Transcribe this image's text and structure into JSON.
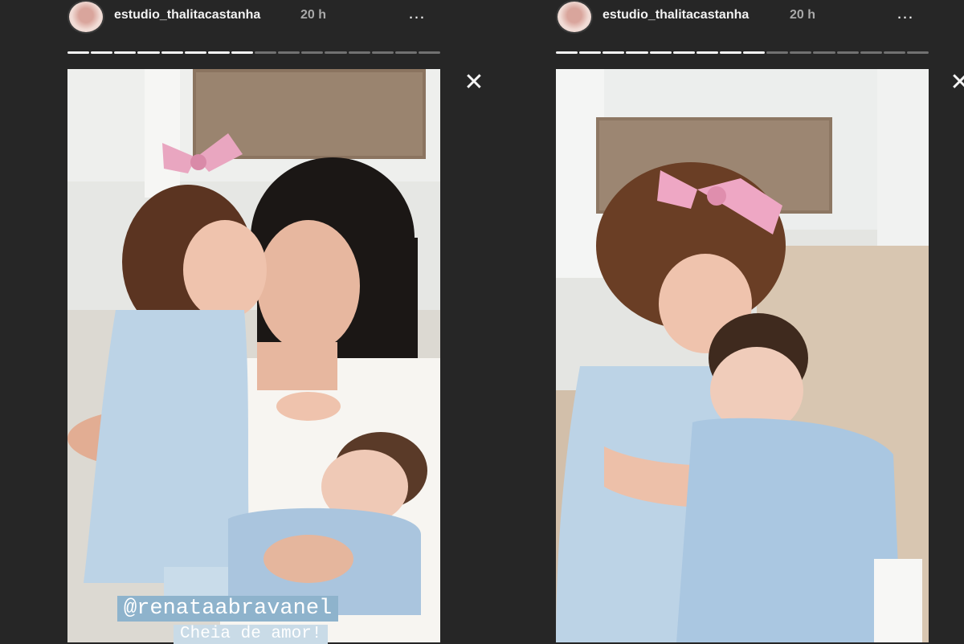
{
  "stories": [
    {
      "username": "estudio_thalitacastanha",
      "time": "20 h",
      "more_icon": "…",
      "progress_segments_total": 16,
      "progress_segments_viewed": 8,
      "mention": "@renataabravanel",
      "caption": "Cheia de amor!"
    },
    {
      "username": "estudio_thalitacastanha",
      "time": "20 h",
      "more_icon": "…",
      "progress_segments_total": 16,
      "progress_segments_viewed": 9
    }
  ],
  "close_icon": "✕",
  "icons": {
    "more": "more-options-icon",
    "close": "close-icon"
  },
  "colors": {
    "background": "#262626",
    "mention_bg": "#8eb3cc"
  }
}
